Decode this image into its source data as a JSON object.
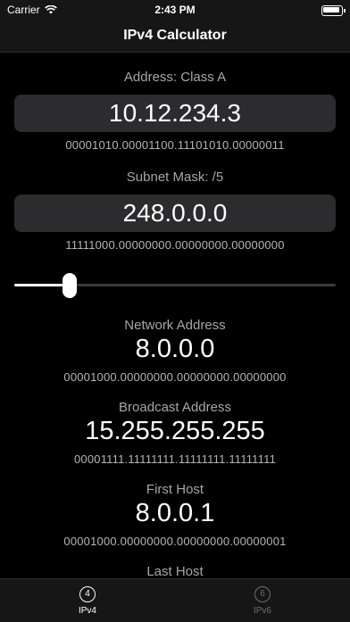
{
  "status": {
    "carrier": "Carrier",
    "time": "2:43 PM"
  },
  "nav": {
    "title": "IPv4 Calculator"
  },
  "address": {
    "label": "Address: Class A",
    "value": "10.12.234.3",
    "binary": "00001010.00001100.11101010.00000011"
  },
  "subnet": {
    "label": "Subnet Mask: /5",
    "value": "248.0.0.0",
    "binary": "11111000.00000000.00000000.00000000",
    "slider_value": 5,
    "slider_max": 32
  },
  "network": {
    "label": "Network Address",
    "value": "8.0.0.0",
    "binary": "00001000.00000000.00000000.00000000"
  },
  "broadcast": {
    "label": "Broadcast Address",
    "value": "15.255.255.255",
    "binary": "00001111.11111111.11111111.11111111"
  },
  "first_host": {
    "label": "First Host",
    "value": "8.0.0.1",
    "binary": "00001000.00000000.00000000.00000001"
  },
  "last_host": {
    "label": "Last Host"
  },
  "tabs": [
    {
      "icon_text": "4",
      "label": "IPv4",
      "icon": "ipv4-tab-icon"
    },
    {
      "icon_text": "6",
      "label": "IPv6",
      "icon": "ipv6-tab-icon"
    }
  ]
}
